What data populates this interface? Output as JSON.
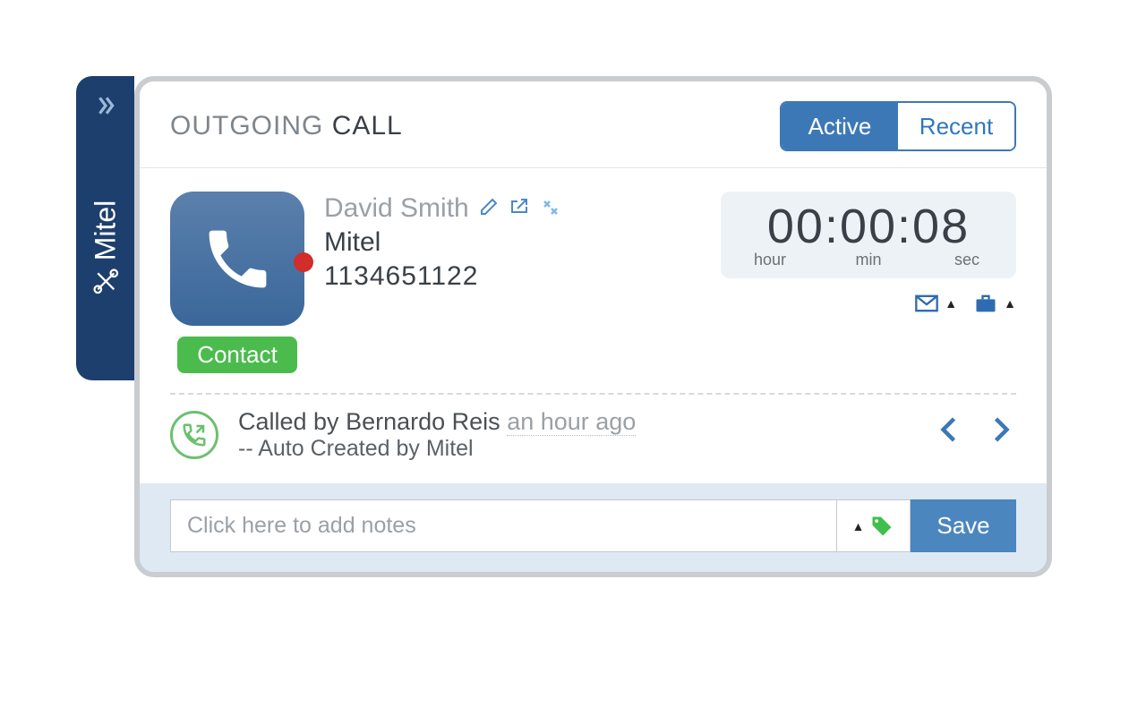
{
  "sidebar": {
    "brand": "Mitel"
  },
  "header": {
    "title_light": "OUTGOING",
    "title_bold": "CALL",
    "tab_active": "Active",
    "tab_recent": "Recent"
  },
  "contact": {
    "name": "David Smith",
    "org": "Mitel",
    "phone": "1134651122",
    "badge": "Contact"
  },
  "timer": {
    "hours": "00",
    "minutes": "00",
    "seconds": "08",
    "label_hour": "hour",
    "label_min": "min",
    "label_sec": "sec"
  },
  "log": {
    "prefix": "Called by",
    "caller": "Bernardo Reis",
    "time_ago": "an hour ago",
    "subtitle": "-- Auto Created by Mitel"
  },
  "footer": {
    "notes_placeholder": "Click here to add notes",
    "save_label": "Save"
  }
}
